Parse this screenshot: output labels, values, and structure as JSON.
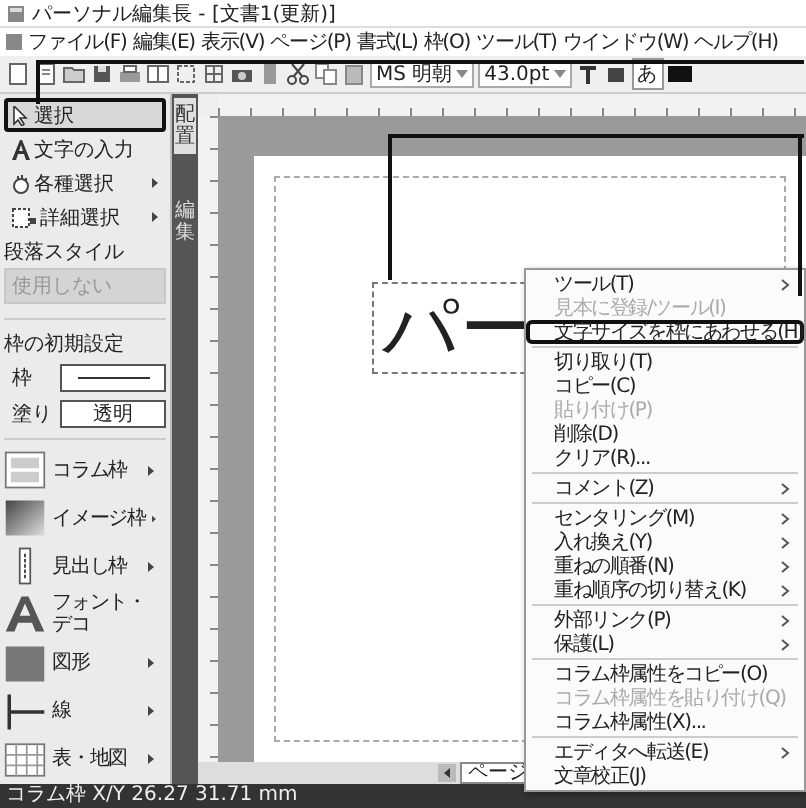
{
  "window": {
    "title": "パーソナル編集長 - [文書1(更新)]"
  },
  "menu_bar": [
    "ファイル(F)",
    "編集(E)",
    "表示(V)",
    "ページ(P)",
    "書式(L)",
    "枠(O)",
    "ツール(T)",
    "ウインドウ(W)",
    "ヘルプ(H)"
  ],
  "toolbar": {
    "font": "MS 明朝",
    "size": "43.0pt",
    "kana_button": "あ"
  },
  "side_panel": {
    "tools": [
      {
        "kind": "select",
        "label": "選択",
        "selected": true,
        "submenu": false
      },
      {
        "kind": "text",
        "label": "文字の入力",
        "selected": false,
        "submenu": false
      },
      {
        "kind": "hand",
        "label": "各種選択",
        "selected": false,
        "submenu": true
      },
      {
        "kind": "marquee",
        "label": "詳細選択",
        "selected": false,
        "submenu": true
      }
    ],
    "paragraph_style": {
      "label": "段落スタイル",
      "value": "使用しない",
      "disabled": true
    },
    "frame_defaults": {
      "title": "枠の初期設定",
      "border_label": "枠",
      "fill_label": "塗り",
      "fill_value": "透明"
    },
    "frames": [
      {
        "kind": "column",
        "label": "コラム枠",
        "submenu": true
      },
      {
        "kind": "image",
        "label": "イメージ枠",
        "submenu": true
      },
      {
        "kind": "heading",
        "label": "見出し枠",
        "submenu": true
      },
      {
        "kind": "font",
        "label": "フォント・デコ",
        "submenu": false
      },
      {
        "kind": "shape",
        "label": "図形",
        "submenu": true
      },
      {
        "kind": "line",
        "label": "線",
        "submenu": true
      },
      {
        "kind": "table",
        "label": "表・地図",
        "submenu": true
      }
    ]
  },
  "side_tabs": [
    {
      "label": "配置",
      "selected": true
    },
    {
      "label": "編集",
      "selected": false
    }
  ],
  "canvas": {
    "frame_text": "パー",
    "page_tab": "ページ"
  },
  "context_menu": [
    {
      "kind": "item",
      "label": "ツール(T)",
      "disabled": false,
      "submenu": true,
      "highlighted": false
    },
    {
      "kind": "item",
      "label": "見本に登録/ツール(I)",
      "disabled": true,
      "submenu": false,
      "highlighted": false
    },
    {
      "kind": "item",
      "label": "文字サイズを枠にあわせる(H)",
      "disabled": false,
      "submenu": false,
      "highlighted": true
    },
    {
      "kind": "separator"
    },
    {
      "kind": "item",
      "label": "切り取り(T)",
      "disabled": false,
      "submenu": false,
      "highlighted": false
    },
    {
      "kind": "item",
      "label": "コピー(C)",
      "disabled": false,
      "submenu": false,
      "highlighted": false
    },
    {
      "kind": "item",
      "label": "貼り付け(P)",
      "disabled": true,
      "submenu": false,
      "highlighted": false
    },
    {
      "kind": "item",
      "label": "削除(D)",
      "disabled": false,
      "submenu": false,
      "highlighted": false
    },
    {
      "kind": "item",
      "label": "クリア(R)...",
      "disabled": false,
      "submenu": false,
      "highlighted": false
    },
    {
      "kind": "separator"
    },
    {
      "kind": "item",
      "label": "コメント(Z)",
      "disabled": false,
      "submenu": true,
      "highlighted": false
    },
    {
      "kind": "separator"
    },
    {
      "kind": "item",
      "label": "センタリング(M)",
      "disabled": false,
      "submenu": true,
      "highlighted": false
    },
    {
      "kind": "item",
      "label": "入れ換え(Y)",
      "disabled": false,
      "submenu": true,
      "highlighted": false
    },
    {
      "kind": "item",
      "label": "重ねの順番(N)",
      "disabled": false,
      "submenu": true,
      "highlighted": false
    },
    {
      "kind": "item",
      "label": "重ね順序の切り替え(K)",
      "disabled": false,
      "submenu": true,
      "highlighted": false
    },
    {
      "kind": "separator"
    },
    {
      "kind": "item",
      "label": "外部リンク(P)",
      "disabled": false,
      "submenu": true,
      "highlighted": false
    },
    {
      "kind": "item",
      "label": "保護(L)",
      "disabled": false,
      "submenu": true,
      "highlighted": false
    },
    {
      "kind": "separator"
    },
    {
      "kind": "item",
      "label": "コラム枠属性をコピー(O)",
      "disabled": false,
      "submenu": false,
      "highlighted": false
    },
    {
      "kind": "item",
      "label": "コラム枠属性を貼り付け(Q)",
      "disabled": true,
      "submenu": false,
      "highlighted": false
    },
    {
      "kind": "item",
      "label": "コラム枠属性(X)...",
      "disabled": false,
      "submenu": false,
      "highlighted": false
    },
    {
      "kind": "separator"
    },
    {
      "kind": "item",
      "label": "エディタへ転送(E)",
      "disabled": false,
      "submenu": true,
      "highlighted": false
    },
    {
      "kind": "item",
      "label": "文章校正(J)",
      "disabled": false,
      "submenu": false,
      "highlighted": false
    }
  ],
  "status_bar": "コラム枠 X/Y 26.27 31.71 mm"
}
